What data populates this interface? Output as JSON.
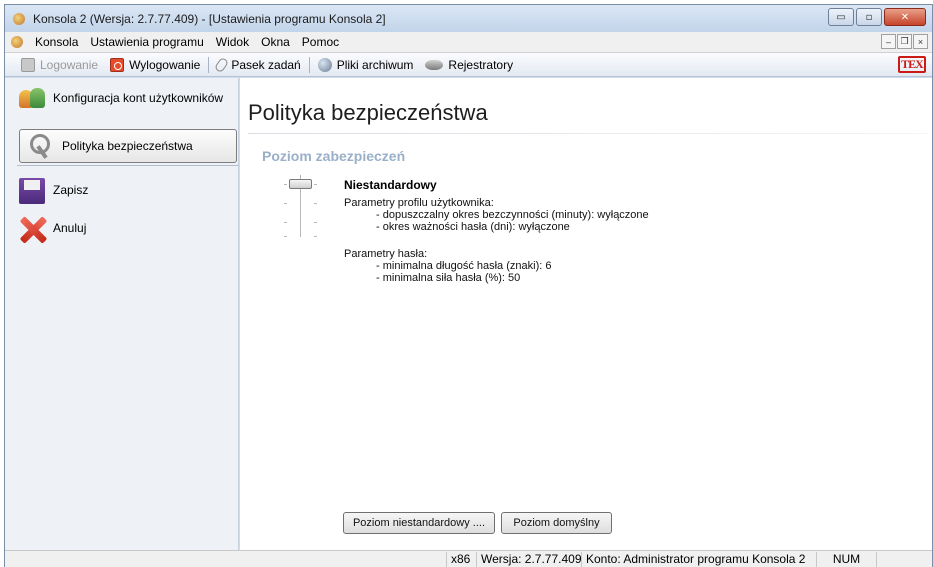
{
  "window": {
    "title": "Konsola 2 (Wersja:  2.7.77.409) - [Ustawienia programu Konsola 2]",
    "min_glyph": "▭",
    "max_glyph": "▫",
    "close_glyph": "✕"
  },
  "menubar": {
    "items": [
      "Konsola",
      "Ustawienia programu",
      "Widok",
      "Okna",
      "Pomoc"
    ],
    "mdi_min": "–",
    "mdi_restore": "❐",
    "mdi_close": "×"
  },
  "toolbar": {
    "login": "Logowanie",
    "logout": "Wylogowanie",
    "taskbar": "Pasek zadań",
    "archives": "Pliki archiwum",
    "recorders": "Rejestratory",
    "brand": "TEX"
  },
  "sidebar": {
    "items": [
      {
        "label": "Konfiguracja kont użytkowników",
        "icon": "users-icon"
      },
      {
        "label": "Polityka bezpieczeństwa",
        "icon": "keys-icon"
      },
      {
        "label": "Zapisz",
        "icon": "save-icon"
      },
      {
        "label": "Anuluj",
        "icon": "cancel-icon"
      }
    ],
    "selected_index": 1
  },
  "main": {
    "title": "Polityka bezpieczeństwa",
    "section_title": "Poziom zabezpieczeń",
    "level_name": "Niestandardowy",
    "profile_header": "Parametry profilu użytkownika:",
    "profile_lines": [
      "- dopuszczalny okres bezczynności (minuty): wyłączone",
      "- okres ważności hasła (dni): wyłączone"
    ],
    "password_header": "Parametry hasła:",
    "password_lines": [
      "- minimalna długość hasła (znaki): 6",
      "- minimalna siła hasła (%): 50"
    ],
    "btn_custom": "Poziom niestandardowy ....",
    "btn_default": "Poziom domyślny"
  },
  "statusbar": {
    "arch": "x86",
    "version": "Wersja: 2.7.77.409",
    "account": "Konto: Administrator programu Konsola 2",
    "num": "NUM"
  }
}
